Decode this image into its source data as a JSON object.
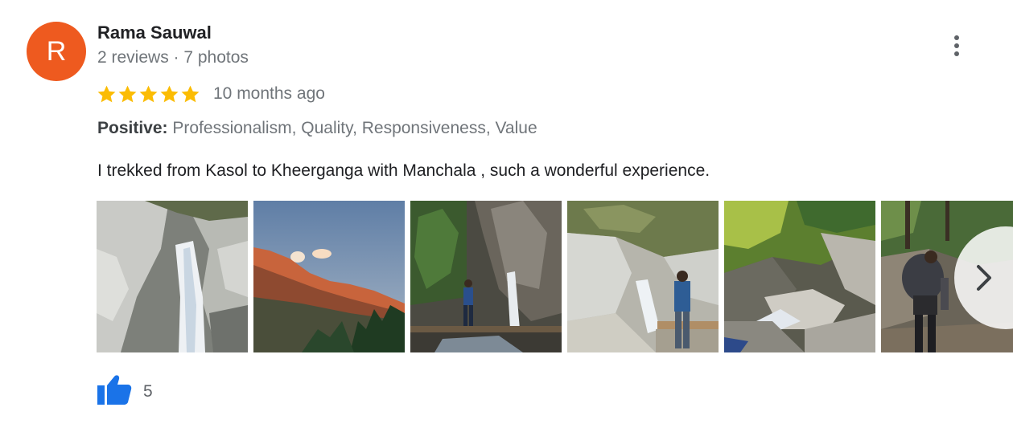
{
  "reviewer": {
    "initial": "R",
    "name": "Rama Sauwal",
    "meta": "2 reviews · 7 photos",
    "avatar_color": "#ee5a1f"
  },
  "rating": {
    "stars": 5,
    "max": 5,
    "star_color": "#fbbc04",
    "date": "10 months ago"
  },
  "positive": {
    "label": "Positive:",
    "values": "Professionalism, Quality, Responsiveness, Value"
  },
  "review_text": "I trekked from Kasol to Kheerganga with Manchala , such a wonderful experience.",
  "photos": [
    {
      "subject": "waterfall over grey rocks"
    },
    {
      "subject": "sunset-lit mountain ridge"
    },
    {
      "subject": "person crossing log bridge by waterfall"
    },
    {
      "subject": "person standing near waterfall"
    },
    {
      "subject": "rocky stream in forest"
    },
    {
      "subject": "hiker with backpack on trail"
    }
  ],
  "icons": {
    "more": "more-vert-icon",
    "next": "chevron-right-icon",
    "like": "thumb-up-icon"
  },
  "like_count": "5",
  "like_color": "#1a73e8"
}
